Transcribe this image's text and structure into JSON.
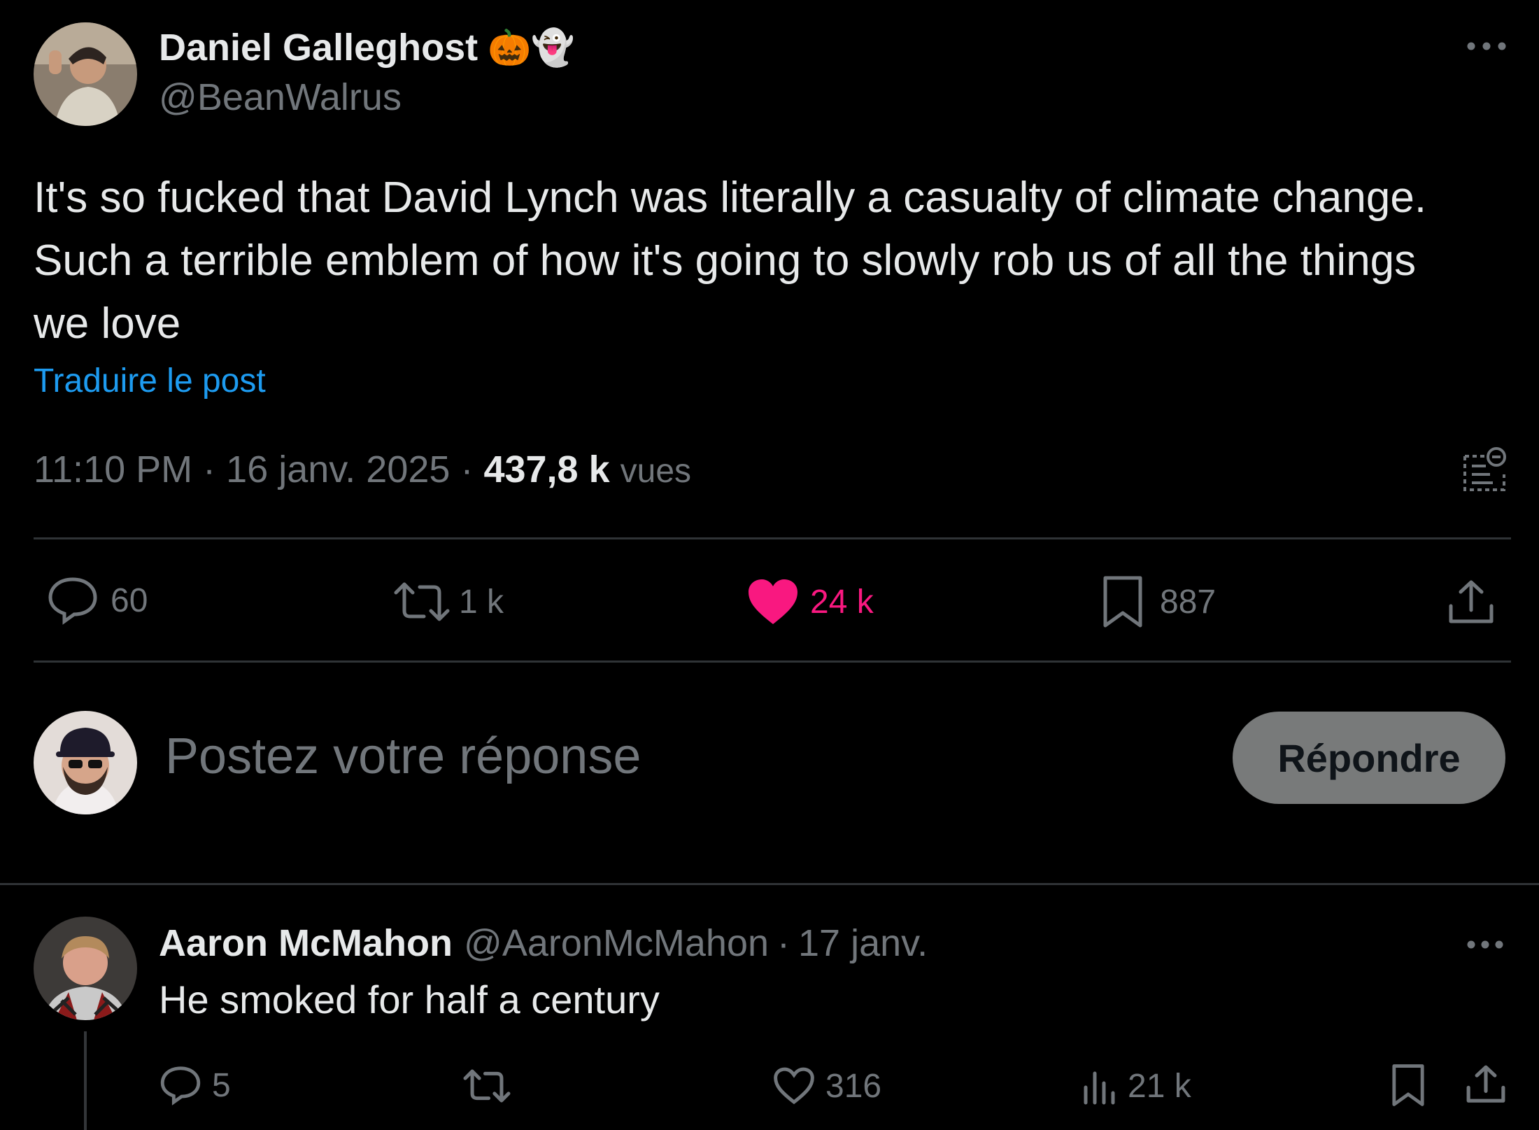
{
  "tweet": {
    "author_name": "Daniel Galleghost",
    "name_emojis": [
      "🎃",
      "👻"
    ],
    "handle": "@BeanWalrus",
    "text_lines": [
      "It's so fucked that David Lynch was literally a casualty of climate change.",
      "Such a terrible emblem of how it's going to slowly rob us of all the things",
      "we love"
    ],
    "translate_link": "Traduire le post",
    "time": "11:10 PM",
    "date": "16 janv. 2025",
    "separator": "·",
    "views_count": "437,8 k",
    "views_label": "vues",
    "more_icon": "more-horizontal-icon",
    "stats": {
      "replies": "60",
      "reposts": "1 k",
      "likes": "24 k",
      "bookmarks": "887"
    },
    "like_color": "#f91880"
  },
  "compose": {
    "placeholder": "Postez votre réponse",
    "reply_button": "Répondre"
  },
  "reply": {
    "author_name": "Aaron McMahon",
    "handle": "@AaronMcMahon",
    "separator": "·",
    "date": "17 janv.",
    "text": "He smoked for half a century",
    "stats": {
      "replies": "5",
      "likes": "316",
      "views": "21 k"
    }
  },
  "colors": {
    "background": "#000000",
    "text": "#e7e9ea",
    "muted": "#71767b",
    "link": "#1d9bf0",
    "divider": "#2f3336",
    "like": "#f91880"
  }
}
